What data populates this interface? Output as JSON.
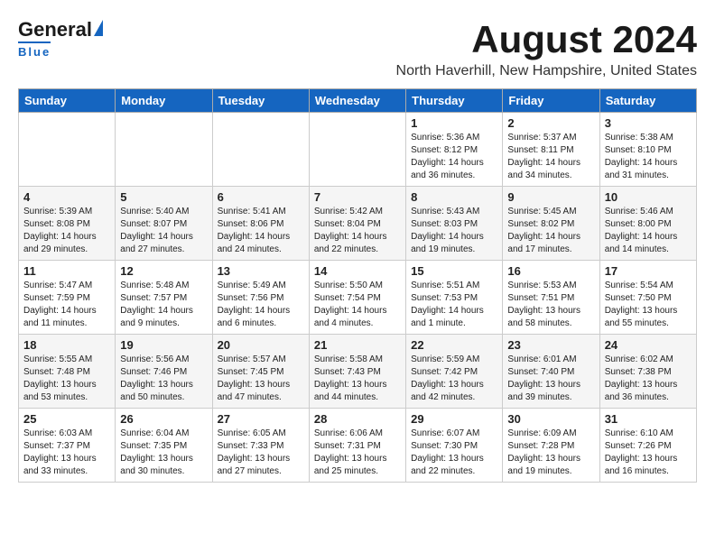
{
  "header": {
    "logo_general": "General",
    "logo_blue": "Blue",
    "month_year": "August 2024",
    "location": "North Haverhill, New Hampshire, United States"
  },
  "weekdays": [
    "Sunday",
    "Monday",
    "Tuesday",
    "Wednesday",
    "Thursday",
    "Friday",
    "Saturday"
  ],
  "weeks": [
    [
      {
        "day": "",
        "info": ""
      },
      {
        "day": "",
        "info": ""
      },
      {
        "day": "",
        "info": ""
      },
      {
        "day": "",
        "info": ""
      },
      {
        "day": "1",
        "info": "Sunrise: 5:36 AM\nSunset: 8:12 PM\nDaylight: 14 hours\nand 36 minutes."
      },
      {
        "day": "2",
        "info": "Sunrise: 5:37 AM\nSunset: 8:11 PM\nDaylight: 14 hours\nand 34 minutes."
      },
      {
        "day": "3",
        "info": "Sunrise: 5:38 AM\nSunset: 8:10 PM\nDaylight: 14 hours\nand 31 minutes."
      }
    ],
    [
      {
        "day": "4",
        "info": "Sunrise: 5:39 AM\nSunset: 8:08 PM\nDaylight: 14 hours\nand 29 minutes."
      },
      {
        "day": "5",
        "info": "Sunrise: 5:40 AM\nSunset: 8:07 PM\nDaylight: 14 hours\nand 27 minutes."
      },
      {
        "day": "6",
        "info": "Sunrise: 5:41 AM\nSunset: 8:06 PM\nDaylight: 14 hours\nand 24 minutes."
      },
      {
        "day": "7",
        "info": "Sunrise: 5:42 AM\nSunset: 8:04 PM\nDaylight: 14 hours\nand 22 minutes."
      },
      {
        "day": "8",
        "info": "Sunrise: 5:43 AM\nSunset: 8:03 PM\nDaylight: 14 hours\nand 19 minutes."
      },
      {
        "day": "9",
        "info": "Sunrise: 5:45 AM\nSunset: 8:02 PM\nDaylight: 14 hours\nand 17 minutes."
      },
      {
        "day": "10",
        "info": "Sunrise: 5:46 AM\nSunset: 8:00 PM\nDaylight: 14 hours\nand 14 minutes."
      }
    ],
    [
      {
        "day": "11",
        "info": "Sunrise: 5:47 AM\nSunset: 7:59 PM\nDaylight: 14 hours\nand 11 minutes."
      },
      {
        "day": "12",
        "info": "Sunrise: 5:48 AM\nSunset: 7:57 PM\nDaylight: 14 hours\nand 9 minutes."
      },
      {
        "day": "13",
        "info": "Sunrise: 5:49 AM\nSunset: 7:56 PM\nDaylight: 14 hours\nand 6 minutes."
      },
      {
        "day": "14",
        "info": "Sunrise: 5:50 AM\nSunset: 7:54 PM\nDaylight: 14 hours\nand 4 minutes."
      },
      {
        "day": "15",
        "info": "Sunrise: 5:51 AM\nSunset: 7:53 PM\nDaylight: 14 hours\nand 1 minute."
      },
      {
        "day": "16",
        "info": "Sunrise: 5:53 AM\nSunset: 7:51 PM\nDaylight: 13 hours\nand 58 minutes."
      },
      {
        "day": "17",
        "info": "Sunrise: 5:54 AM\nSunset: 7:50 PM\nDaylight: 13 hours\nand 55 minutes."
      }
    ],
    [
      {
        "day": "18",
        "info": "Sunrise: 5:55 AM\nSunset: 7:48 PM\nDaylight: 13 hours\nand 53 minutes."
      },
      {
        "day": "19",
        "info": "Sunrise: 5:56 AM\nSunset: 7:46 PM\nDaylight: 13 hours\nand 50 minutes."
      },
      {
        "day": "20",
        "info": "Sunrise: 5:57 AM\nSunset: 7:45 PM\nDaylight: 13 hours\nand 47 minutes."
      },
      {
        "day": "21",
        "info": "Sunrise: 5:58 AM\nSunset: 7:43 PM\nDaylight: 13 hours\nand 44 minutes."
      },
      {
        "day": "22",
        "info": "Sunrise: 5:59 AM\nSunset: 7:42 PM\nDaylight: 13 hours\nand 42 minutes."
      },
      {
        "day": "23",
        "info": "Sunrise: 6:01 AM\nSunset: 7:40 PM\nDaylight: 13 hours\nand 39 minutes."
      },
      {
        "day": "24",
        "info": "Sunrise: 6:02 AM\nSunset: 7:38 PM\nDaylight: 13 hours\nand 36 minutes."
      }
    ],
    [
      {
        "day": "25",
        "info": "Sunrise: 6:03 AM\nSunset: 7:37 PM\nDaylight: 13 hours\nand 33 minutes."
      },
      {
        "day": "26",
        "info": "Sunrise: 6:04 AM\nSunset: 7:35 PM\nDaylight: 13 hours\nand 30 minutes."
      },
      {
        "day": "27",
        "info": "Sunrise: 6:05 AM\nSunset: 7:33 PM\nDaylight: 13 hours\nand 27 minutes."
      },
      {
        "day": "28",
        "info": "Sunrise: 6:06 AM\nSunset: 7:31 PM\nDaylight: 13 hours\nand 25 minutes."
      },
      {
        "day": "29",
        "info": "Sunrise: 6:07 AM\nSunset: 7:30 PM\nDaylight: 13 hours\nand 22 minutes."
      },
      {
        "day": "30",
        "info": "Sunrise: 6:09 AM\nSunset: 7:28 PM\nDaylight: 13 hours\nand 19 minutes."
      },
      {
        "day": "31",
        "info": "Sunrise: 6:10 AM\nSunset: 7:26 PM\nDaylight: 13 hours\nand 16 minutes."
      }
    ]
  ]
}
